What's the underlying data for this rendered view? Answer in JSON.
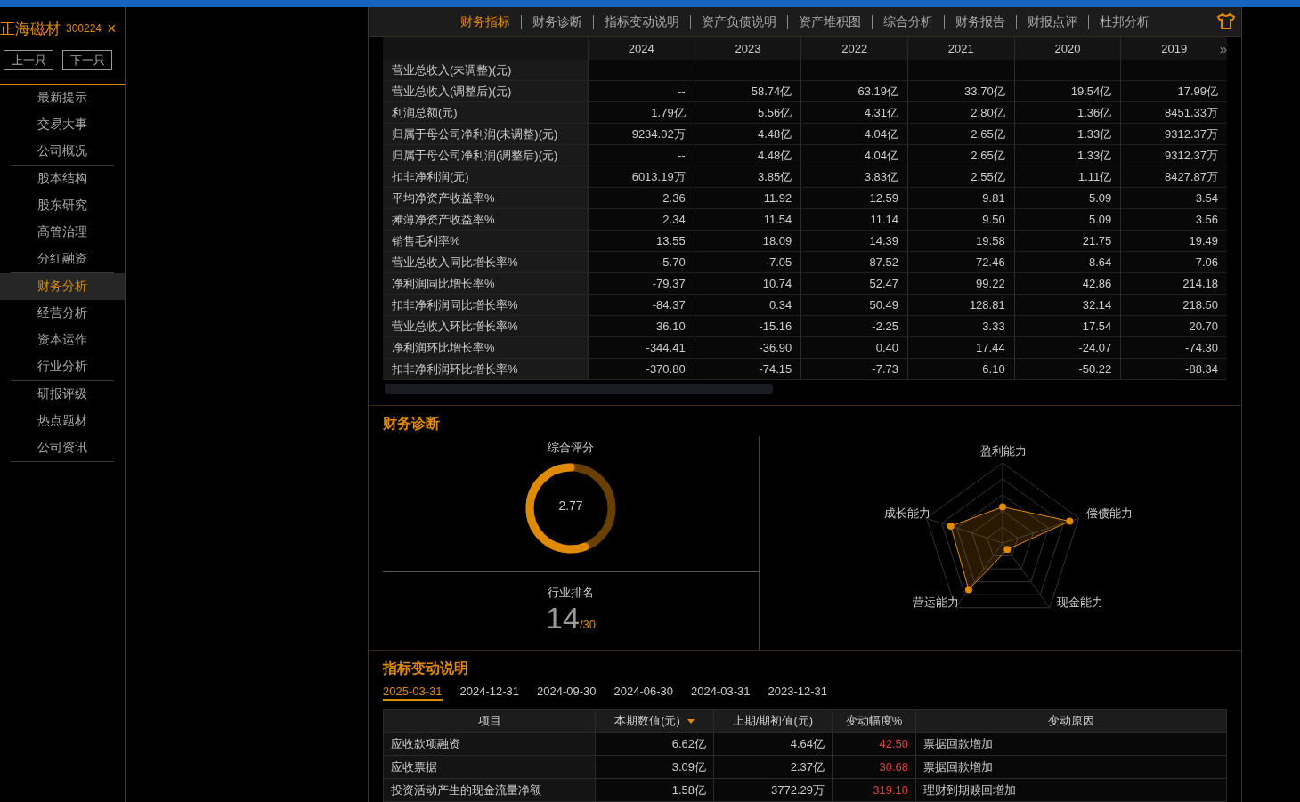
{
  "stock": {
    "name": "正海磁材",
    "code": "300224",
    "close": "×"
  },
  "nav_buttons": [
    "上一只",
    "下一只"
  ],
  "sidebar": {
    "groups": [
      [
        {
          "label": "最新提示",
          "selected": false
        },
        {
          "label": "交易大事",
          "selected": false
        },
        {
          "label": "公司概况",
          "selected": false
        }
      ],
      [
        {
          "label": "股本结构",
          "selected": false
        },
        {
          "label": "股东研究",
          "selected": false
        },
        {
          "label": "高管治理",
          "selected": false
        },
        {
          "label": "分红融资",
          "selected": false
        }
      ],
      [
        {
          "label": "财务分析",
          "selected": true
        },
        {
          "label": "经营分析",
          "selected": false
        },
        {
          "label": "资本运作",
          "selected": false
        },
        {
          "label": "行业分析",
          "selected": false
        }
      ],
      [
        {
          "label": "研报评级",
          "selected": false
        },
        {
          "label": "热点题材",
          "selected": false
        },
        {
          "label": "公司资讯",
          "selected": false
        }
      ]
    ]
  },
  "tabs": [
    {
      "label": "财务指标",
      "selected": true
    },
    {
      "label": "财务诊断",
      "selected": false
    },
    {
      "label": "指标变动说明",
      "selected": false
    },
    {
      "label": "资产负债说明",
      "selected": false
    },
    {
      "label": "资产堆积图",
      "selected": false
    },
    {
      "label": "综合分析",
      "selected": false
    },
    {
      "label": "财务报告",
      "selected": false
    },
    {
      "label": "财报点评",
      "selected": false
    },
    {
      "label": "杜邦分析",
      "selected": false
    }
  ],
  "table": {
    "more": "»",
    "columns": [
      "2024",
      "2023",
      "2022",
      "2021",
      "2020",
      "2019"
    ],
    "rows": [
      {
        "label": "营业总收入(未调整)(元)",
        "values": []
      },
      {
        "label": "营业总收入(调整后)(元)",
        "values": [
          "--",
          "58.74亿",
          "63.19亿",
          "33.70亿",
          "19.54亿",
          "17.99亿"
        ]
      },
      {
        "label": "利润总额(元)",
        "values": [
          "1.79亿",
          "5.56亿",
          "4.31亿",
          "2.80亿",
          "1.36亿",
          "8451.33万"
        ]
      },
      {
        "label": "归属于母公司净利润(未调整)(元)",
        "values": [
          "9234.02万",
          "4.48亿",
          "4.04亿",
          "2.65亿",
          "1.33亿",
          "9312.37万"
        ]
      },
      {
        "label": "归属于母公司净利润(调整后)(元)",
        "values": [
          "--",
          "4.48亿",
          "4.04亿",
          "2.65亿",
          "1.33亿",
          "9312.37万"
        ]
      },
      {
        "label": "扣非净利润(元)",
        "values": [
          "6013.19万",
          "3.85亿",
          "3.83亿",
          "2.55亿",
          "1.11亿",
          "8427.87万"
        ]
      },
      {
        "label": "平均净资产收益率%",
        "values": [
          "2.36",
          "11.92",
          "12.59",
          "9.81",
          "5.09",
          "3.54"
        ]
      },
      {
        "label": "摊薄净资产收益率%",
        "values": [
          "2.34",
          "11.54",
          "11.14",
          "9.50",
          "5.09",
          "3.56"
        ]
      },
      {
        "label": "销售毛利率%",
        "values": [
          "13.55",
          "18.09",
          "14.39",
          "19.58",
          "21.75",
          "19.49"
        ]
      },
      {
        "label": "营业总收入同比增长率%",
        "values": [
          "-5.70",
          "-7.05",
          "87.52",
          "72.46",
          "8.64",
          "7.06"
        ]
      },
      {
        "label": "净利润同比增长率%",
        "values": [
          "-79.37",
          "10.74",
          "52.47",
          "99.22",
          "42.86",
          "214.18"
        ]
      },
      {
        "label": "扣非净利润同比增长率%",
        "values": [
          "-84.37",
          "0.34",
          "50.49",
          "128.81",
          "32.14",
          "218.50"
        ]
      },
      {
        "label": "营业总收入环比增长率%",
        "values": [
          "36.10",
          "-15.16",
          "-2.25",
          "3.33",
          "17.54",
          "20.70"
        ]
      },
      {
        "label": "净利润环比增长率%",
        "values": [
          "-344.41",
          "-36.90",
          "0.40",
          "17.44",
          "-24.07",
          "-74.30"
        ]
      },
      {
        "label": "扣非净利润环比增长率%",
        "values": [
          "-370.80",
          "-74.15",
          "-7.73",
          "6.10",
          "-50.22",
          "-88.34"
        ]
      }
    ]
  },
  "diagnosis": {
    "title": "财务诊断",
    "score_label": "综合评分",
    "score": "2.77",
    "level": 0.555,
    "rank_label": "行业排名",
    "rank": "14",
    "rank_total": "/30",
    "radar_axes": [
      "盈利能力",
      "偿债能力",
      "现金能力",
      "营运能力",
      "成长能力"
    ]
  },
  "changes": {
    "title": "指标变动说明",
    "dates": [
      {
        "label": "2025-03-31",
        "selected": true
      },
      {
        "label": "2024-12-31",
        "selected": false
      },
      {
        "label": "2024-09-30",
        "selected": false
      },
      {
        "label": "2024-06-30",
        "selected": false
      },
      {
        "label": "2024-03-31",
        "selected": false
      },
      {
        "label": "2023-12-31",
        "selected": false
      }
    ],
    "columns": [
      "项目",
      "本期数值(元)",
      "上期/期初值(元)",
      "变动幅度%",
      "变动原因"
    ],
    "rows": [
      {
        "item": "应收款项融资",
        "current": "6.62亿",
        "previous": "4.64亿",
        "change": "42.50",
        "reason": "票据回款增加"
      },
      {
        "item": "应收票据",
        "current": "3.09亿",
        "previous": "2.37亿",
        "change": "30.68",
        "reason": "票据回款增加"
      },
      {
        "item": "投资活动产生的现金流量净额",
        "current": "1.58亿",
        "previous": "3772.29万",
        "change": "319.10",
        "reason": "理财到期赎回增加"
      }
    ]
  }
}
